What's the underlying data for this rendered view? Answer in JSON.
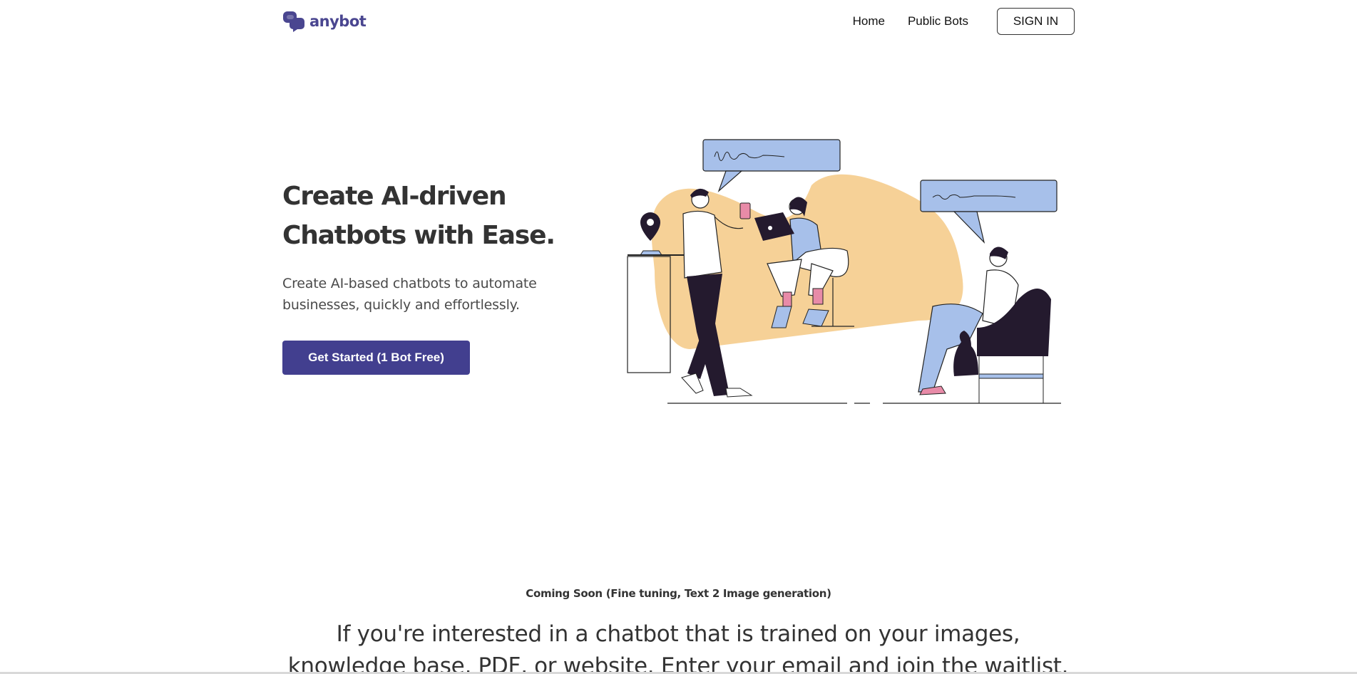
{
  "header": {
    "brand": "anybot",
    "nav": [
      {
        "label": "Home"
      },
      {
        "label": "Public Bots"
      }
    ],
    "signin_label": "SIGN IN"
  },
  "hero": {
    "title": "Create AI-driven Chatbots with Ease.",
    "subtitle": "Create AI-based chatbots to automate businesses, quickly and effortlessly.",
    "cta_label": "Get Started (1 Bot Free)"
  },
  "coming_soon": "Coming Soon (Fine tuning, Text 2 Image generation)",
  "waitlist_text": "If you're interested in a chatbot that is trained on your images, knowledge base, PDF, or website. Enter your email and join the waitlist.",
  "colors": {
    "brand": "#4a4690",
    "cta": "#423f8f",
    "bubble": "#a7c0ea",
    "blob": "#f6d197",
    "dark": "#241a2e",
    "pink": "#e88ba8"
  },
  "icons": [
    "anybot-logo-icon",
    "location-pin-icon",
    "chat-bubble-icon",
    "laptop-icon",
    "coffee-cup-icon",
    "cat-icon"
  ]
}
